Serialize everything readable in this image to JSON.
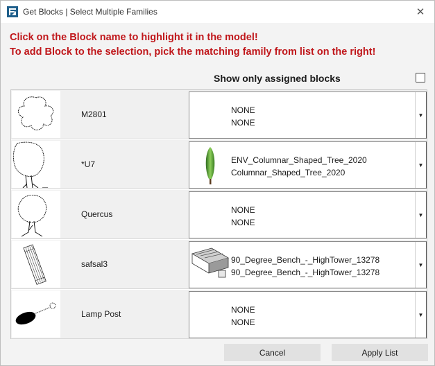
{
  "window": {
    "title": "Get Blocks | Select Multiple Families",
    "close_glyph": "✕"
  },
  "instructions": {
    "line1": "Click on the Block name to highlight it in the model!",
    "line2": "To add Block to the selection, pick the matching family from list on the right!"
  },
  "filter": {
    "label": "Show only assigned blocks",
    "checked": false
  },
  "rows": [
    {
      "name": "M2801",
      "thumb_icon": "flower-outline-icon",
      "family_line1": "NONE",
      "family_line2": "NONE",
      "family_icon": ""
    },
    {
      "name": "*U7",
      "thumb_icon": "tree-outline-icon",
      "family_line1": "ENV_Columnar_Shaped_Tree_2020",
      "family_line2": "Columnar_Shaped_Tree_2020",
      "family_icon": "columnar-tree-icon"
    },
    {
      "name": "Quercus",
      "thumb_icon": "oak-tree-outline-icon",
      "family_line1": "NONE",
      "family_line2": "NONE",
      "family_icon": ""
    },
    {
      "name": "safsal3",
      "thumb_icon": "bench-plan-icon",
      "family_line1": "90_Degree_Bench_-_HighTower_13278",
      "family_line2": "90_Degree_Bench_-_HighTower_13278",
      "family_icon": "bench-3d-icon"
    },
    {
      "name": "Lamp Post",
      "thumb_icon": "lamp-post-plan-icon",
      "family_line1": "NONE",
      "family_line2": "NONE",
      "family_icon": ""
    }
  ],
  "buttons": {
    "cancel": "Cancel",
    "apply": "Apply List"
  },
  "colors": {
    "instruction_text": "#c0171b",
    "button_bg": "#e1e1e1"
  }
}
